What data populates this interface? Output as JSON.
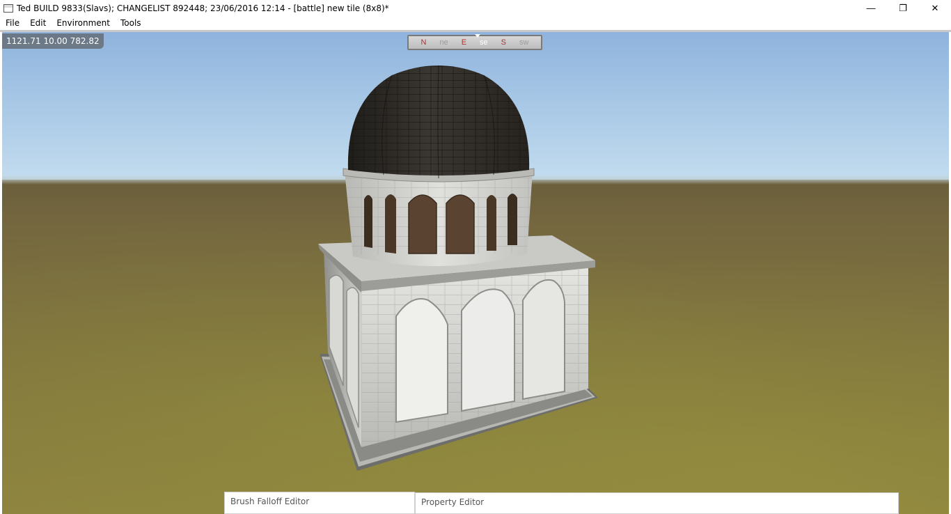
{
  "window": {
    "title": "Ted BUILD 9833(Slavs); CHANGELIST 892448; 23/06/2016 12:14 - [battle] new tile (8x8)*",
    "controls": {
      "minimize": "—",
      "restore": "❐",
      "close": "✕"
    }
  },
  "menu": {
    "items": [
      {
        "label": "File"
      },
      {
        "label": "Edit"
      },
      {
        "label": "Environment"
      },
      {
        "label": "Tools"
      }
    ]
  },
  "viewport": {
    "coordinates": "1121.71 10.00 782.82",
    "compass": {
      "marks": [
        "N",
        "ne",
        "E",
        "se",
        "S",
        "sw"
      ]
    },
    "scene": {
      "object": "domed-stone-building",
      "colors": {
        "sky": "#a9c9e6",
        "ground": "#7c703f",
        "dome": "#2f2c28",
        "stone": "#d9d9d6"
      }
    }
  },
  "panels": {
    "brush_falloff_editor": "Brush Falloff Editor",
    "property_editor": "Property Editor"
  }
}
